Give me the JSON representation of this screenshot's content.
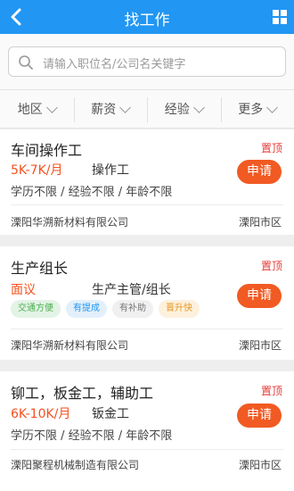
{
  "header": {
    "title": "找工作"
  },
  "search": {
    "placeholder": "请输入职位名/公司名关键字"
  },
  "filters": [
    "地区",
    "薪资",
    "经验",
    "更多"
  ],
  "jobs": [
    {
      "title": "车间操作工",
      "badge": "置顶",
      "salary": "5K-7K/月",
      "role": "操作工",
      "requirements": "学历不限 / 经验不限 / 年龄不限",
      "apply_label": "申请",
      "company": "溧阳华溯新材料有限公司",
      "location": "溧阳市区"
    },
    {
      "title": "生产组长",
      "badge": "置顶",
      "salary": "面议",
      "role": "生产主管/组长",
      "tags": [
        "交通方便",
        "有提成",
        "有补助",
        "晋升快"
      ],
      "apply_label": "申请",
      "company": "溧阳华溯新材料有限公司",
      "location": "溧阳市区"
    },
    {
      "title": "铆工，板金工，辅助工",
      "badge": "置顶",
      "salary": "6K-10K/月",
      "role": "钣金工",
      "requirements": "学历不限 / 经验不限 / 年龄不限",
      "apply_label": "申请",
      "company": "溧阳聚程机械制造有限公司",
      "location": "溧阳市区"
    }
  ],
  "colors": {
    "header": "#2196f3",
    "apply": "#f15a22",
    "salary": "#f4511e",
    "badge": "#e53935"
  },
  "icons": {
    "back": "back-arrow-icon",
    "menu": "grid-menu-icon",
    "search": "search-icon",
    "filter": "chevron-down-icon"
  }
}
